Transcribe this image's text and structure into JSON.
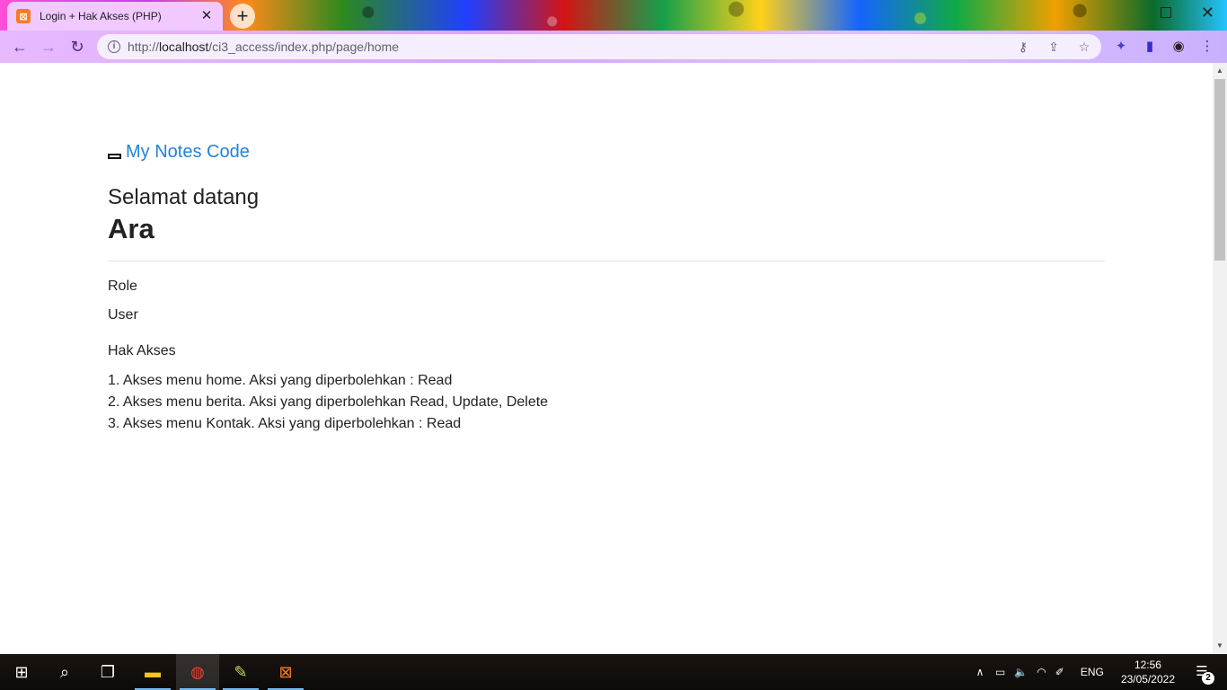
{
  "browser": {
    "tab_title": "Login + Hak Akses (PHP)",
    "url_prefix": "http://",
    "url_host": "localhost",
    "url_path": "/ci3_access/index.php/page/home",
    "accent_color": "#d6a8f5"
  },
  "page": {
    "brand": "My Notes Code",
    "welcome": "Selamat datang",
    "username": "Ara",
    "role_label": "Role",
    "role_value": "User",
    "access_label": "Hak Akses",
    "permissions": [
      "1. Akses menu home. Aksi yang diperbolehkan : Read",
      "2. Akses menu berita. Aksi yang diperbolehkan Read, Update, Delete",
      "3. Akses menu Kontak. Aksi yang diperbolehkan : Read"
    ],
    "link_color": "#2283d9"
  },
  "taskbar": {
    "language": "ENG",
    "time": "12:56",
    "date": "23/05/2022",
    "notification_count": "2"
  }
}
